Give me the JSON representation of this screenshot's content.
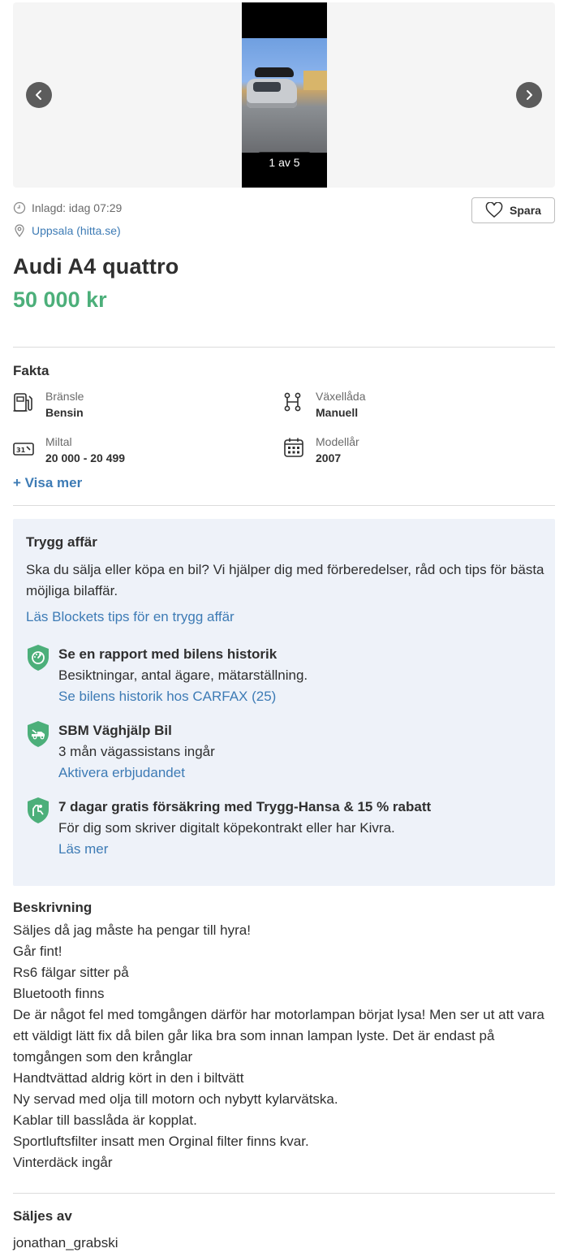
{
  "gallery": {
    "counter": "1 av 5"
  },
  "listing": {
    "posted": "Inlagd: idag 07:29",
    "location": "Uppsala (hitta.se)",
    "save_label": "Spara",
    "title": "Audi A4 quattro",
    "price": "50 000 kr"
  },
  "facts": {
    "heading": "Fakta",
    "items": [
      {
        "label": "Bränsle",
        "value": "Bensin",
        "icon": "fuel-pump-icon"
      },
      {
        "label": "Växellåda",
        "value": "Manuell",
        "icon": "gearbox-icon"
      },
      {
        "label": "Miltal",
        "value": "20 000 - 20 499",
        "icon": "odometer-icon"
      },
      {
        "label": "Modellår",
        "value": "2007",
        "icon": "calendar-icon"
      }
    ],
    "show_more": "+ Visa mer"
  },
  "trygg": {
    "title": "Trygg affär",
    "body": "Ska du sälja eller köpa en bil? Vi hjälper dig med förberedelser, råd och tips för bästa möjliga bilaffär.",
    "tips_link": "Läs Blockets tips för en trygg affär",
    "features": [
      {
        "title": "Se en rapport med bilens historik",
        "text": "Besiktningar, antal ägare, mätarställning.",
        "link": "Se bilens historik hos CARFAX (25)"
      },
      {
        "title": "SBM Väghjälp Bil",
        "text": "3 mån vägassistans ingår",
        "link": "Aktivera erbjudandet"
      },
      {
        "title": "7 dagar gratis försäkring med Trygg-Hansa & 15 % rabatt",
        "text": "För dig som skriver digitalt köpekontrakt eller har Kivra.",
        "link": "Läs mer"
      }
    ],
    "accent_color": "#4caf7a"
  },
  "description": {
    "heading": "Beskrivning",
    "lines": [
      "Säljes då jag måste ha pengar till hyra!",
      "Går fint!",
      "Rs6 fälgar sitter på",
      "Bluetooth finns",
      "De är något fel med tomgången därför har motorlampan börjat lysa! Men ser ut att vara ett väldigt lätt fix då bilen går lika bra som innan lampan lyste. Det är endast på tomgången som den krånglar",
      "Handtvättad aldrig kört in den i biltvätt",
      "Ny servad med olja till motorn och nybytt kylarvätska.",
      "Kablar till basslåda är kopplat.",
      "Sportluftsfilter insatt men Orginal filter finns kvar.",
      "Vinterdäck ingår"
    ]
  },
  "seller": {
    "heading": "Säljes av",
    "name": "jonathan_grabski"
  }
}
